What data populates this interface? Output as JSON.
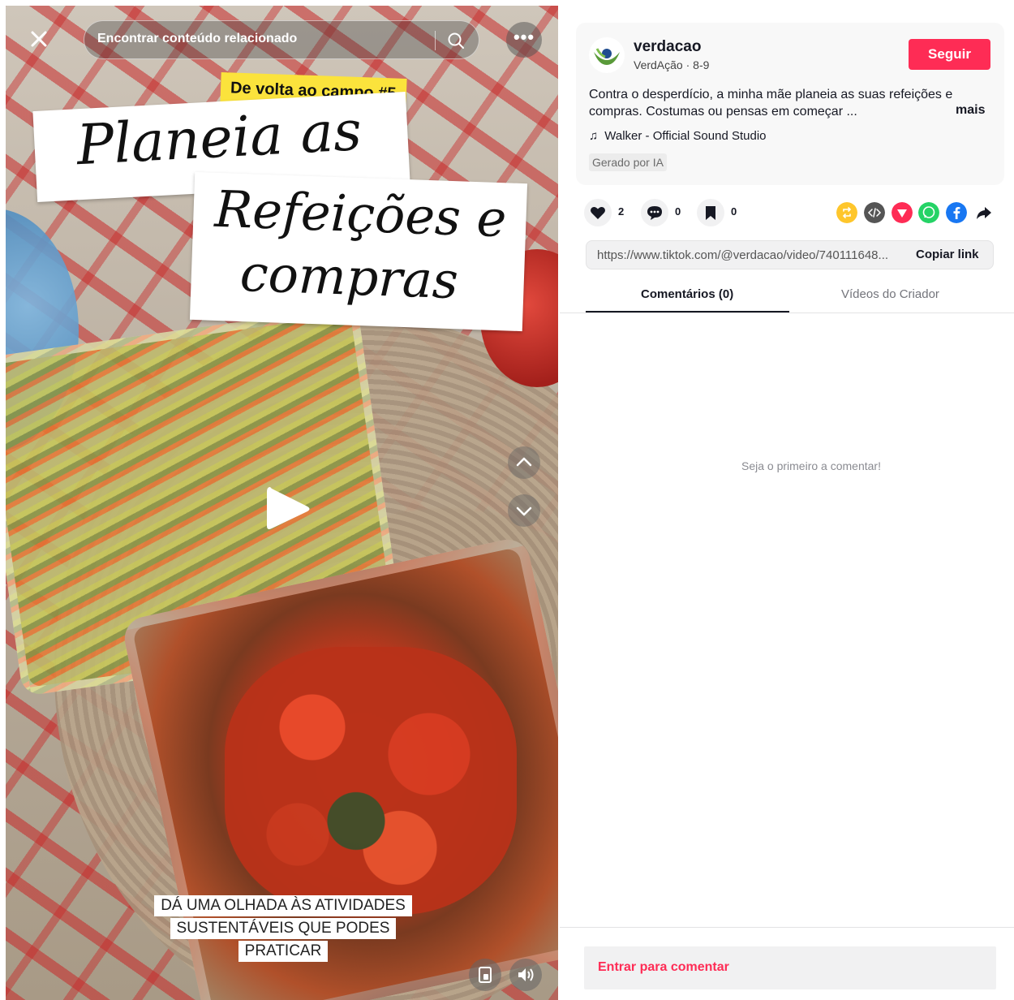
{
  "video": {
    "search_placeholder": "Encontrar conteúdo relacionado",
    "more_label": "•••",
    "tag": "De volta ao campo #5",
    "title_line1": "Planeia as",
    "title_line2": "Refeições e",
    "title_line3": "compras",
    "caption_lines": [
      "DÁ UMA OLHADA ÀS ATIVIDADES",
      "SUSTENTÁVEIS QUE PODES",
      "PRATICAR"
    ]
  },
  "author": {
    "username": "verdacao",
    "subline": "VerdAção · 8-9",
    "follow_label": "Seguir",
    "description": "Contra o desperdício, a minha mãe planeia as suas refeições e compras. Costumas ou pensas em começar ...",
    "more_label": "mais",
    "music": "Walker - Official Sound Studio",
    "ai_badge": "Gerado por IA"
  },
  "actions": {
    "likes": "2",
    "comments": "0",
    "saves": "0"
  },
  "share_icons": [
    "repost-icon",
    "embed-icon",
    "send-icon",
    "whatsapp-icon",
    "facebook-icon",
    "share-arrow-icon"
  ],
  "link": {
    "url": "https://www.tiktok.com/@verdacao/video/740111648...",
    "copy_label": "Copiar link"
  },
  "tabs": {
    "comments": "Comentários (0)",
    "creator_videos": "Vídeos do Criador"
  },
  "comments": {
    "empty_text": "Seja o primeiro a comentar!",
    "login_prompt": "Entrar para comentar"
  },
  "colors": {
    "accent": "#fe2c55",
    "tag_yellow": "#fbe33c"
  }
}
